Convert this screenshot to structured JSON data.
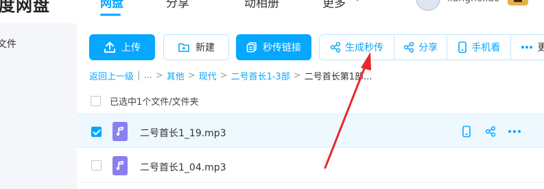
{
  "header": {
    "logo_text": "度网盘",
    "nav": [
      {
        "label": "网盘",
        "active": true
      },
      {
        "label": "分享",
        "active": false
      },
      {
        "label": "动相册",
        "active": false
      },
      {
        "label": "更多",
        "active": false
      }
    ],
    "username": "liangholiao"
  },
  "sidebar": {
    "items": [
      {
        "label": "文件"
      }
    ]
  },
  "toolbar": {
    "upload_label": "上传",
    "new_label": "新建",
    "quick_link_label": "秒传链接",
    "generate_quick_label": "生成秒传",
    "share_label": "分享",
    "phone_view_label": "手机看",
    "more_label": "更"
  },
  "breadcrumb": {
    "back_label": "返回上一级",
    "ellipsis": "...",
    "items": [
      "其他",
      "现代",
      "二号首长1-3部"
    ],
    "current": "二号首长第1部..."
  },
  "selection": {
    "text": "已选中1个文件/文件夹"
  },
  "files": [
    {
      "name": "二号首长1_19.mp3",
      "checked": true
    },
    {
      "name": "二号首长1_04.mp3",
      "checked": false
    }
  ],
  "colors": {
    "accent": "#06a7ff",
    "annotation": "#e8262b",
    "file_icon": "#8b7ff0"
  }
}
